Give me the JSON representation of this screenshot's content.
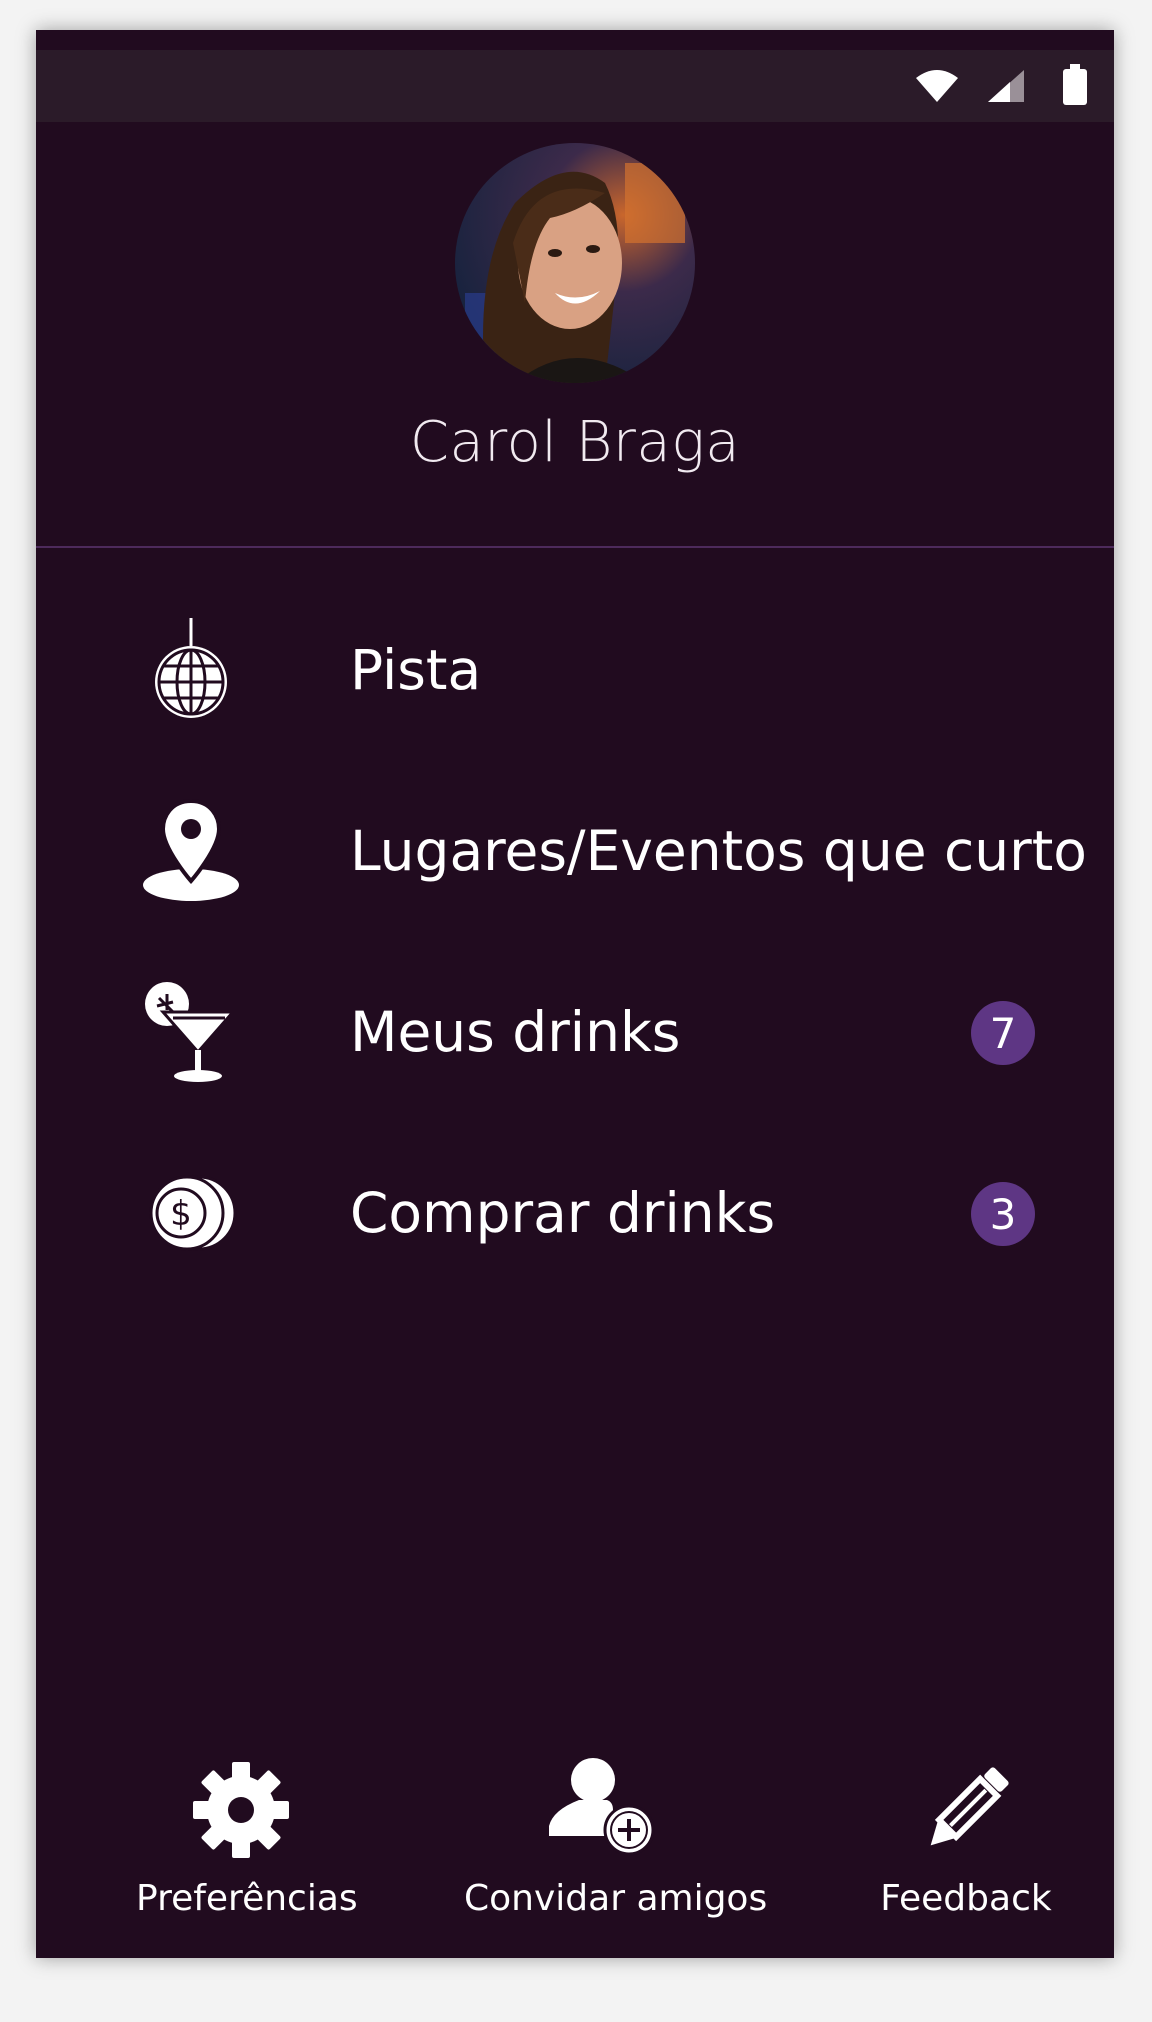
{
  "status_bar": {
    "icons": [
      "wifi-icon",
      "signal-icon",
      "battery-icon"
    ]
  },
  "profile": {
    "name": "Carol Braga",
    "avatar": "profile-photo"
  },
  "menu": [
    {
      "label": "Pista",
      "icon": "disco-ball-icon"
    },
    {
      "label": "Lugares/Eventos que curto",
      "icon": "map-pin-icon"
    },
    {
      "label": "Meus drinks",
      "icon": "cocktail-icon",
      "badge": "7"
    },
    {
      "label": "Comprar drinks",
      "icon": "coins-icon",
      "badge": "3"
    }
  ],
  "bottom_nav": [
    {
      "label": "Preferências",
      "icon": "gear-icon"
    },
    {
      "label": "Convidar amigos",
      "icon": "add-user-icon"
    },
    {
      "label": "Feedback",
      "icon": "pencil-icon"
    }
  ],
  "colors": {
    "background": "#210b1f",
    "status_bar": "#2b1b29",
    "badge": "#5e3684",
    "divider": "#4d2a5b"
  }
}
